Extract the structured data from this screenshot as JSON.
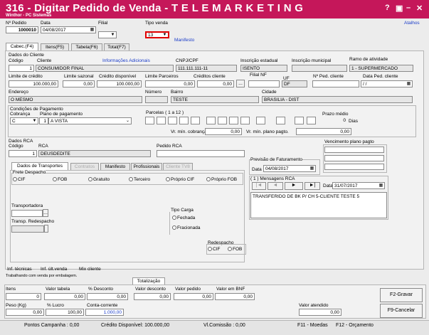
{
  "window": {
    "title": "316 - Digitar Pedido de Venda - T E L E M A R K E T I N G",
    "subtitle": "Winthor - PC Sistemas",
    "shortcuts_link": "Atalhos"
  },
  "header": {
    "num_pedido_label": "Nº Pedido",
    "num_pedido": "1000010",
    "data_label": "Data",
    "data": "04/08/2017",
    "filial_label": "Filial",
    "filial": "",
    "tipo_venda_label": "Tipo venda",
    "tipo_venda": "13",
    "manifesto_link": "Manifesto"
  },
  "main_tabs": [
    "Cabec.(F4)",
    "Itens(F5)",
    "Tabela(F6)",
    "Total(F7)"
  ],
  "cliente": {
    "section": "Dados do Cliente",
    "codigo_label": "Código",
    "codigo": "1",
    "cliente_label": "Cliente",
    "cliente": "CONSUMIDOR FINAL",
    "info_link": "Informações Adicionais",
    "cnpj_label": "CNPJ/CPF",
    "cnpj": "111.111.111-11",
    "insc_est_label": "Inscrição estadual",
    "insc_est": "ISENTO",
    "insc_mun_label": "Inscrição municipal",
    "insc_mun": "",
    "ramo_label": "Ramo de atividade",
    "ramo": "1 - SUPERMERCADO",
    "limite_cred_label": "Limite de crédito",
    "limite_cred": "100.000,00",
    "limite_saz_label": "Limite sazonal",
    "limite_saz": "0,00",
    "credito_disp_label": "Crédito disponível",
    "credito_disp": "100.000,00",
    "limite_parc_label": "Limite Parceiros",
    "limite_parc": "0,00",
    "creditos_cli_label": "Créditos cliente",
    "creditos_cli": "0,00",
    "filial_nf_label": "Filial NF",
    "uf_label": "UF",
    "uf": "DF",
    "ped_cliente_label": "Nº Ped. cliente",
    "data_ped_label": "Data Ped. cliente",
    "data_ped": "/ /",
    "endereco_label": "Endereço",
    "endereco": "O MESMO",
    "numero_label": "Número",
    "bairro_label": "Bairro",
    "bairro": "TESTE",
    "cidade_label": "Cidade",
    "cidade": "BRASILIA - DIST"
  },
  "pagamento": {
    "section": "Condições de Pagamento",
    "cobranca_label": "Cobrança",
    "cobranca": "C",
    "plano_label": "Plano de pagamento",
    "plano_codigo": "1",
    "plano": "A VISTA",
    "parcelas_label": "Parcelas ( 1 a 12 )",
    "prazo_label": "Prazo médio",
    "prazo": "0",
    "dias_label": "Dias",
    "vr_min_cob_label": "Vr. mín. cobrança",
    "vr_min_cob": "0,00",
    "vr_min_plano_label": "Vr. mín. plano pagto.",
    "vr_min_plano": "0,00"
  },
  "rca": {
    "section": "Dados RCA",
    "codigo_label": "Código",
    "codigo": "1",
    "rca_label": "RCA",
    "rca": "DEUSDEDITE",
    "pedido_rca_label": "Pedido RCA"
  },
  "vencimento_label": "Vencimento plano pagto",
  "sub_tabs": [
    "Dados de Transportes",
    "Contratos",
    "Manifesto",
    "Profissionais",
    "Cliente TV8"
  ],
  "transporte": {
    "frete_label": "Frete Despacho",
    "frete_options": [
      "CIF",
      "FOB",
      "Gratuito",
      "Terceiro",
      "Próprio CIF",
      "Próprio FOB"
    ],
    "transportadora_label": "Transportadora",
    "transp_redespacho_label": "Transp. Redespacho",
    "tipo_carga_label": "Tipo Carga",
    "tipo_carga_options": [
      "Fechada",
      "Fracionada"
    ],
    "redespacho_label": "Redespacho",
    "redespacho_options": [
      "CIF",
      "FOB"
    ]
  },
  "previsao": {
    "label": "Previsão de Faturamento",
    "data_label": "Data",
    "data": "04/08/2017"
  },
  "mensagens": {
    "label": "( 1 ) Mensagens RCA",
    "nav": [
      "|◄",
      "◄",
      "►",
      "►|"
    ],
    "data_label": "Data",
    "data": "31/07/2017",
    "texto": "TRANSFERIDO DE BK P/ CH 5-CLIENTE TESTE 5"
  },
  "bottom_links": [
    "Inf. técnicas",
    "Inf. últ.venda",
    "Mix cliente"
  ],
  "working_text": "Trabalhando com venda por embalagem.",
  "totalizacao_tab": "Totalização",
  "totais": {
    "itens_label": "Itens",
    "itens": "0",
    "valor_tabela_label": "Valor tabela",
    "valor_tabela": "0,00",
    "pct_desc_label": "% Desconto",
    "pct_desc": "0,00",
    "valor_desc_label": "Valor desconto",
    "valor_desc": "0,00",
    "valor_pedido_label": "Valor pedido",
    "valor_pedido": "0,00",
    "valor_bnf_label": "Valor em BNF",
    "valor_bnf": "0,00",
    "peso_label": "Peso (Kg)",
    "peso": "0,00",
    "pct_lucro_label": "% Lucro",
    "pct_lucro": "100,00",
    "conta_corrente_label": "Conta-corrente",
    "conta_corrente": "1.000,00",
    "valor_atendido_label": "Valor atendido",
    "valor_atendido": "0,00"
  },
  "buttons": {
    "gravar": "F2-Gravar",
    "cancelar": "F9-Cancelar"
  },
  "statusbar": {
    "pontos": "Pontos Campanha : 0,00",
    "credito": "Crédito Disponível: 100.000,00",
    "comissao": "Vl.Comissão : 0,00",
    "moedas": "F11 - Moedas",
    "orcamento": "F12 - Orçamento"
  },
  "colors": {
    "title_bar": "#c5175a",
    "link_blue": "#1a3cc9",
    "highlight_red": "#e00000"
  }
}
